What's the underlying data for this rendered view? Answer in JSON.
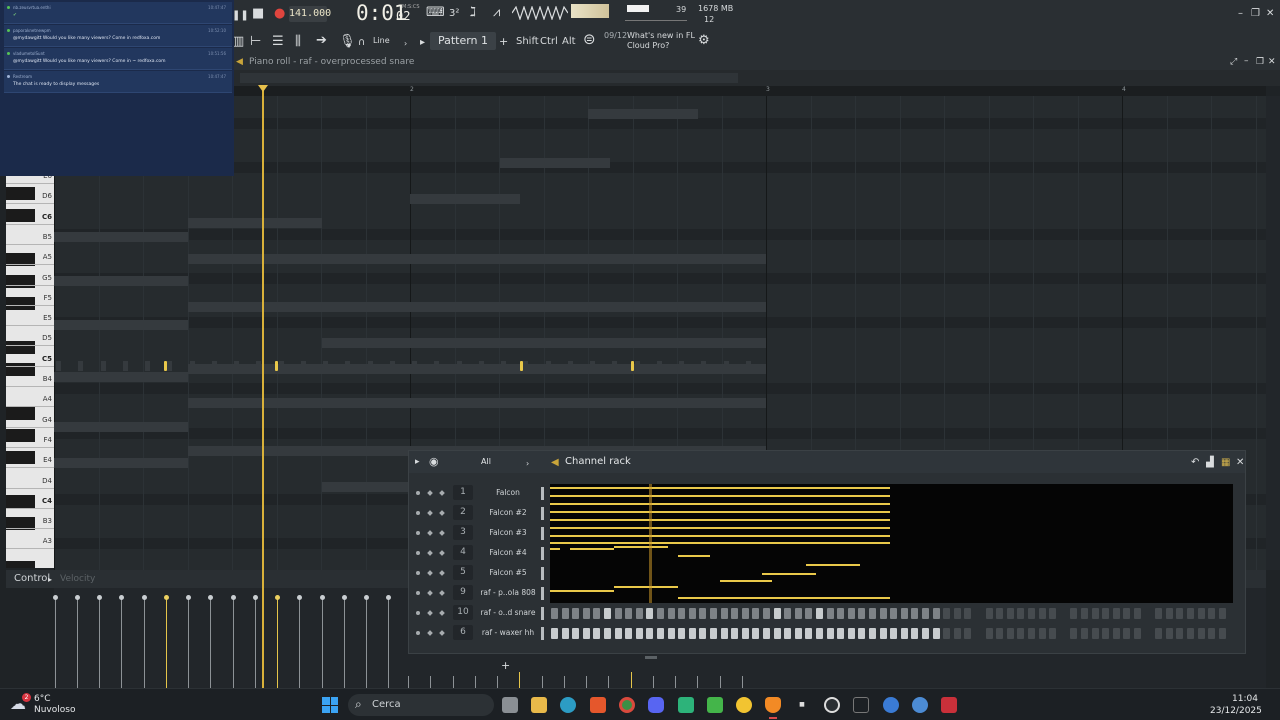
{
  "toolbar": {
    "tempo": "141.000",
    "time_label": "M:S:CS",
    "time_main": "0:01",
    "time_sub": "02",
    "cpu": "39",
    "memory": "1678 MB",
    "voices": "12",
    "snap": "Line",
    "pattern": "Pattern 1",
    "shift": "Shift",
    "ctrl": "Ctrl",
    "alt": "Alt",
    "news_count": "09/12",
    "news_text": "What's new in FL Cloud Pro?"
  },
  "chat": {
    "messages": [
      {
        "user": "nb.zeusvrtua.enthi",
        "time": "10:47:47",
        "text": "✔"
      },
      {
        "user": "paporaknetnewpm",
        "time": "10:52:10",
        "text": "@mydawgitt Would you like many viewers? Come in    redfoxa.com"
      },
      {
        "user": "vladumetolSunt",
        "time": "10:51:56",
        "text": "@mydawgitt Would you like many viewers? Come in ~ redfoxa.com"
      },
      {
        "user": "Restream",
        "time": "10:47:47",
        "text": "The chat is ready to display messages"
      }
    ]
  },
  "piano_roll": {
    "title": "Piano roll - raf - overprocessed snare",
    "bars": [
      "2",
      "3",
      "4"
    ],
    "keys": [
      "E6",
      "D6",
      "C6",
      "B5",
      "A5",
      "G5",
      "F5",
      "E5",
      "D5",
      "C5",
      "B4",
      "A4",
      "G4",
      "F4",
      "E4",
      "D4",
      "C4",
      "B3",
      "A3"
    ],
    "control_label": "Control",
    "control_param": "Velocity"
  },
  "channel_rack": {
    "title": "Channel rack",
    "filter": "All",
    "channels": [
      {
        "num": "1",
        "name": "Falcon"
      },
      {
        "num": "2",
        "name": "Falcon #2"
      },
      {
        "num": "3",
        "name": "Falcon #3"
      },
      {
        "num": "4",
        "name": "Falcon #4"
      },
      {
        "num": "5",
        "name": "Falcon #5"
      },
      {
        "num": "9",
        "name": "raf - p..ola 808"
      },
      {
        "num": "10",
        "name": "raf - o..d snare"
      },
      {
        "num": "6",
        "name": "raf - waxer hh"
      }
    ]
  },
  "taskbar": {
    "weather_temp": "6°C",
    "weather_desc": "Nuvoloso",
    "weather_badge": "2",
    "search_placeholder": "Cerca",
    "clock_time": "11:04",
    "clock_date": "23/12/2025"
  }
}
